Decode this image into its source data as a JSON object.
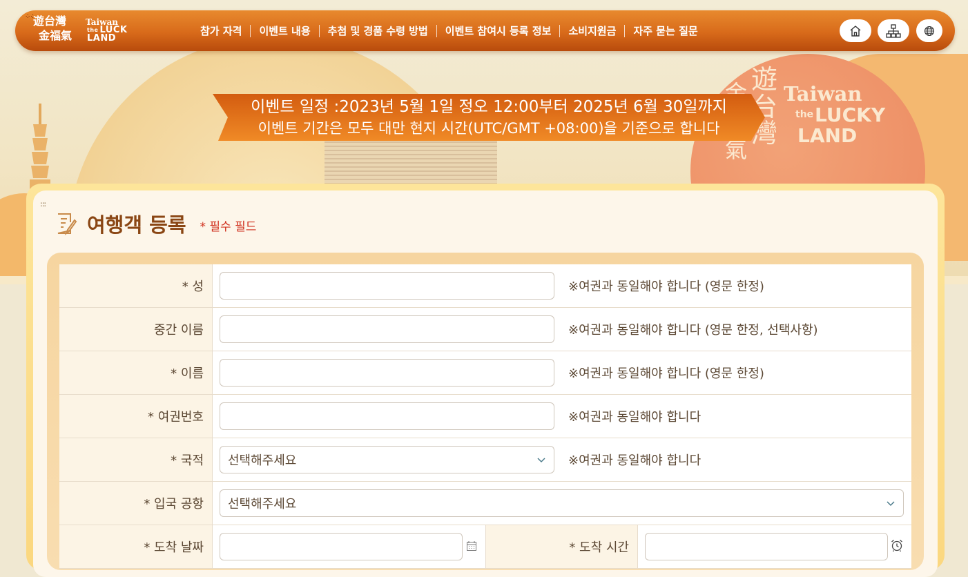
{
  "logo": {
    "cjk_line1": "遊台灣",
    "cjk_line2": "金福氣",
    "en_line1": "Taiwan",
    "en_the": "the",
    "en_line2": "LUCK",
    "en_line3": "LAND"
  },
  "nav": {
    "menu": [
      "참가 자격",
      "이벤트 내용",
      "추첨 및 경품 수령 방법",
      "이벤트 참여시 등록 정보",
      "소비지원금",
      "자주 묻는 질문"
    ],
    "buttons": [
      "home-icon",
      "sitemap-icon",
      "globe-icon"
    ]
  },
  "hero": {
    "line1": "이벤트 일정 :2023년 5월 1일 정오 12:00부터 2025년 6월 30일까지",
    "line2": "이벤트 기간은 모두 대만 현지 시간(UTC/GMT +08:00)을 기준으로 합니다",
    "art_cjk": [
      "遊",
      "台",
      "灣",
      "金",
      "福",
      "氣"
    ],
    "art_en": [
      "Taiwan",
      "the",
      "LUCKY",
      "LAND"
    ]
  },
  "form": {
    "grip": ":::",
    "title": "여행객 등록",
    "required_note": "* 필수 필드",
    "rows": [
      {
        "label": "* 성",
        "hint": "※여권과 동일해야 합니다 (영문 한정)",
        "value": ""
      },
      {
        "label": "중간 이름",
        "hint": "※여권과 동일해야 합니다 (영문 한정, 선택사항)",
        "value": ""
      },
      {
        "label": "* 이름",
        "hint": "※여권과 동일해야 합니다 (영문 한정)",
        "value": ""
      },
      {
        "label": "* 여권번호",
        "hint": "※여권과 동일해야 합니다",
        "value": ""
      },
      {
        "label": "* 국적",
        "hint": "※여권과 동일해야 합니다",
        "selected": "선택해주세요"
      },
      {
        "label": "* 입국 공항",
        "selected": "선택해주세요"
      },
      {
        "label": "* 도착 날짜",
        "label2": "* 도착 시간",
        "date": "",
        "time": ""
      }
    ]
  },
  "colors": {
    "nav_top": "#e88a2e",
    "nav_bottom": "#b84b0c",
    "title": "#8a4614",
    "required": "#d0301e",
    "label_bg": "#fcf4e5",
    "card_border": "#fbd77f"
  }
}
